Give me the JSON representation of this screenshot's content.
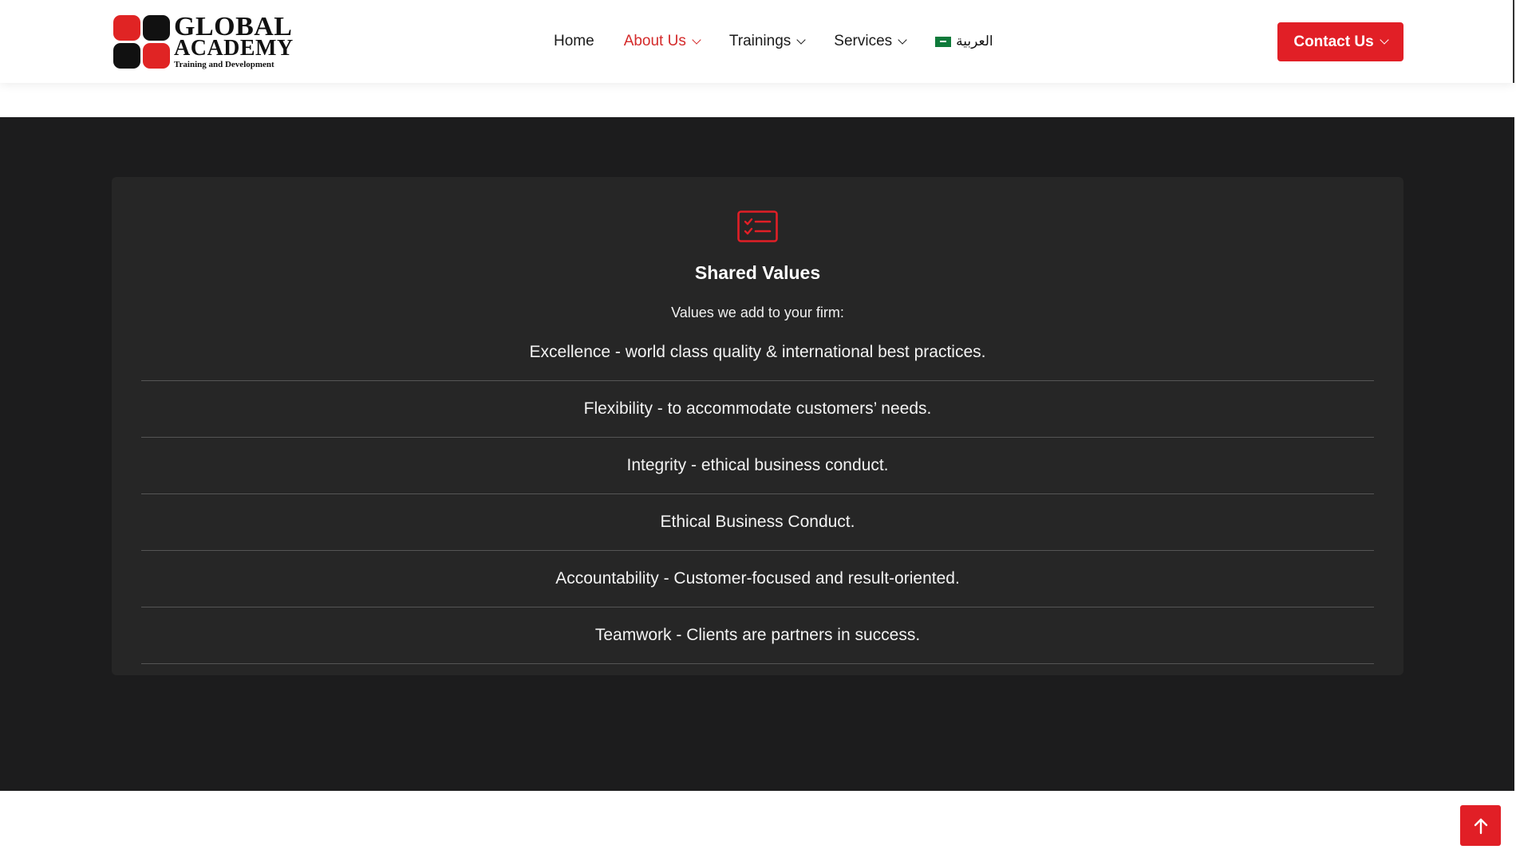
{
  "header": {
    "logo": {
      "line1": "GLOBAL",
      "line2": "ACADEMY",
      "tagline": "Training and Development"
    },
    "nav": {
      "home": "Home",
      "about": "About Us",
      "trainings": "Trainings",
      "services": "Services",
      "language": "العربية"
    },
    "contact_label": "Contact Us"
  },
  "card": {
    "icon": "checklist-icon",
    "title": "Shared Values",
    "subtitle": "Values we add to your firm:",
    "items": [
      "Excellence - world class quality & international best practices.",
      "Flexibility - to accommodate customers’ needs.",
      "Integrity - ethical business conduct.",
      "Ethical Business Conduct.",
      "Accountability - Customer-focused and result-oriented.",
      "Teamwork - Clients are partners in success."
    ]
  },
  "colors": {
    "accent": "#e11f26",
    "dark_bg": "#1c1c1d",
    "card_bg": "#262626"
  },
  "back_to_top_icon": "arrow-up-icon"
}
